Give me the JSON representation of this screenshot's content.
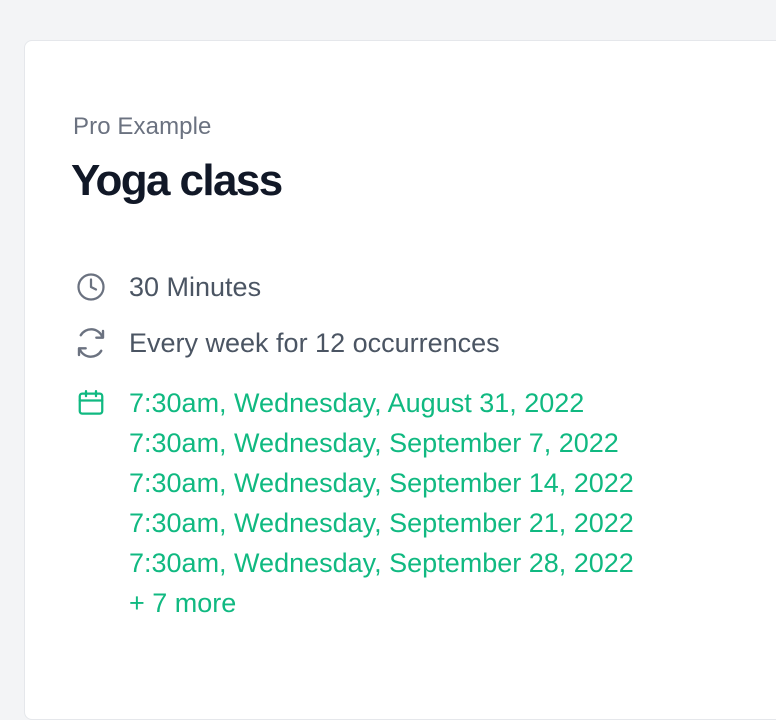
{
  "event": {
    "organizer": "Pro Example",
    "title": "Yoga class",
    "duration_label": "30 Minutes",
    "recurrence_label": "Every week for 12 occurrences",
    "dates": [
      "7:30am, Wednesday, August 31, 2022",
      "7:30am, Wednesday, September 7, 2022",
      "7:30am, Wednesday, September 14, 2022",
      "7:30am, Wednesday, September 21, 2022",
      "7:30am, Wednesday, September 28, 2022"
    ],
    "more_label": "+ 7 more"
  },
  "icons": {
    "duration": "clock-icon",
    "recurrence": "refresh-icon",
    "dates": "calendar-icon"
  },
  "colors": {
    "page_bg": "#f3f4f6",
    "card_bg": "#ffffff",
    "title": "#111827",
    "muted": "#6b7280",
    "body": "#4b5563",
    "accent": "#10b981"
  }
}
